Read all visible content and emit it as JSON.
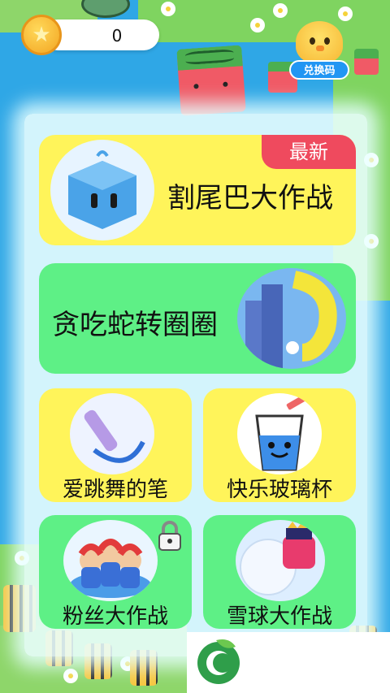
{
  "coins": {
    "value": "0"
  },
  "redeem": {
    "label": "兑换码"
  },
  "games": [
    {
      "title": "割尾巴大作战",
      "badge": "最新"
    },
    {
      "title": "贪吃蛇转圈圈"
    },
    {
      "title": "爱跳舞的笔"
    },
    {
      "title": "快乐玻璃杯"
    },
    {
      "title": "粉丝大作战",
      "locked": true
    },
    {
      "title": "雪球大作战"
    }
  ],
  "colors": {
    "card_yellow": "#fff45a",
    "card_green": "#5ef086",
    "badge_red": "#ef4a5e",
    "background_water": "#2fa7e6",
    "grass": "#7fd460"
  },
  "icons": [
    "star-coin-icon",
    "chick-icon",
    "lock-icon",
    "leaf-logo-icon"
  ]
}
